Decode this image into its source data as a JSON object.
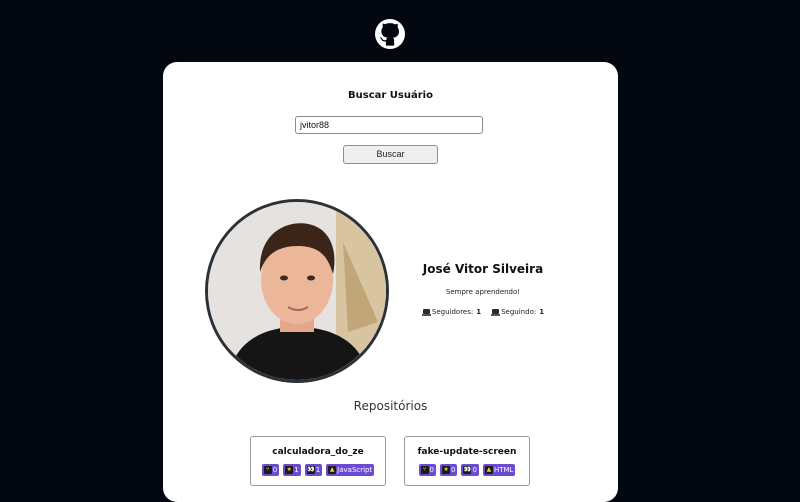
{
  "header": {
    "logo_icon": "github-octocat-icon"
  },
  "search": {
    "title": "Buscar Usuário",
    "input_value": "jvitor88",
    "button_label": "Buscar"
  },
  "profile": {
    "name": "José Vitor Silveira",
    "bio": "Sempre aprendendo!",
    "followers_label": "Seguidores:",
    "followers_count": "1",
    "following_label": "Seguindo:",
    "following_count": "1"
  },
  "repos": {
    "title": "Repositórios",
    "items": [
      {
        "name": "calculadora_do_ze",
        "forks": "0",
        "stars": "1",
        "watchers": "1",
        "language": "JavaScript"
      },
      {
        "name": "fake-update-screen",
        "forks": "0",
        "stars": "0",
        "watchers": "0",
        "language": "HTML"
      }
    ]
  },
  "colors": {
    "background": "#03070f",
    "card": "#ffffff",
    "badge": "#6a4bd2"
  }
}
